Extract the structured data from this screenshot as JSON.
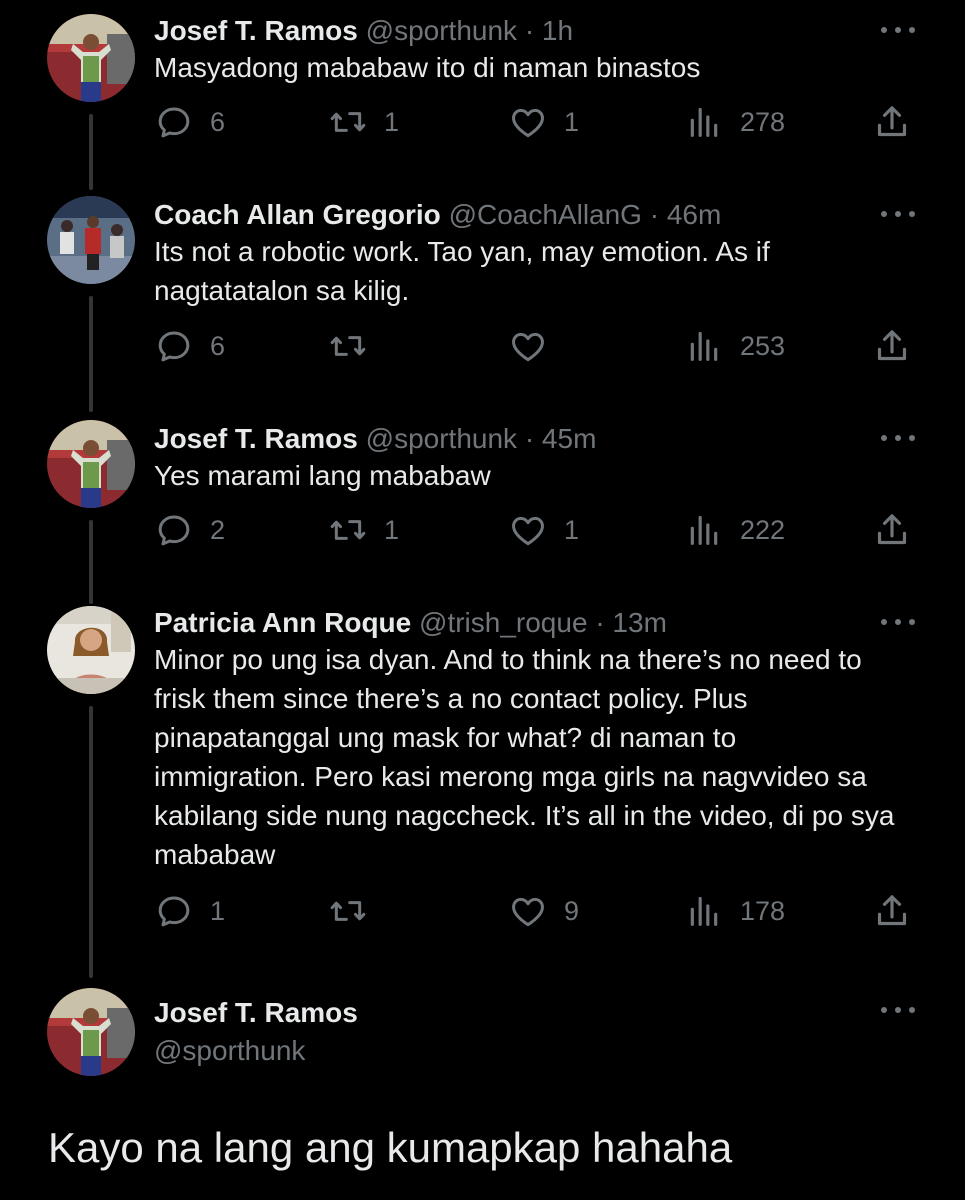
{
  "colors": {
    "background": "#000000",
    "text": "#e7e9ea",
    "muted": "#71767b",
    "thread_line": "#333639"
  },
  "icons": {
    "reply": "speech-bubble-icon",
    "retweet": "retweet-arrows-icon",
    "like": "heart-icon",
    "views": "bar-chart-icon",
    "share": "share-upload-icon",
    "more": "ellipsis-icon"
  },
  "tweets": [
    {
      "name": "Josef T. Ramos",
      "handle": "@sporthunk",
      "separator": "·",
      "time": "1h",
      "text": "Masyadong mababaw ito di naman binastos",
      "replies": "6",
      "retweets": "1",
      "likes": "1",
      "views": "278"
    },
    {
      "name": "Coach Allan Gregorio",
      "handle": "@CoachAllanG",
      "separator": "·",
      "time": "46m",
      "text": "Its not a robotic work. Tao yan, may emotion. As if nagtatatalon sa kilig.",
      "replies": "6",
      "retweets": "",
      "likes": "",
      "views": "253"
    },
    {
      "name": "Josef T. Ramos",
      "handle": "@sporthunk",
      "separator": "·",
      "time": "45m",
      "text": "Yes marami lang mababaw",
      "replies": "2",
      "retweets": "1",
      "likes": "1",
      "views": "222"
    },
    {
      "name": "Patricia Ann Roque",
      "handle": "@trish_roque",
      "separator": "·",
      "time": "13m",
      "text": "Minor po ung isa dyan. And to think na there’s no need to frisk them since there’s a no contact policy. Plus pinapatanggal ung mask for what? di naman to immigration. Pero kasi merong mga girls na nagvvideo sa kabilang side nung nagccheck. It’s all in the video, di po sya mababaw",
      "replies": "1",
      "retweets": "",
      "likes": "9",
      "views": "178"
    }
  ],
  "focused_tweet": {
    "name": "Josef T. Ramos",
    "handle": "@sporthunk",
    "text": "Kayo na lang ang kumapkap hahaha"
  }
}
